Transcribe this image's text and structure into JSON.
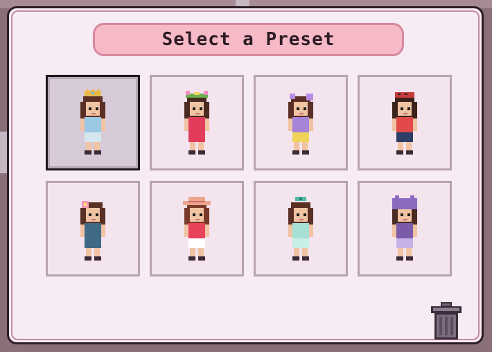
{
  "dialog": {
    "title": "Select a Preset"
  },
  "presets": [
    {
      "name": "preset-1",
      "accessory": "crown",
      "hair": "#5a2f24",
      "top": "#9ac9e6",
      "bottom": "#d5e6ee",
      "accent": "#e7b94a",
      "selected": true
    },
    {
      "name": "preset-2",
      "accessory": "flower-wreath",
      "hair": "#4a2b22",
      "top": "#e23c5d",
      "bottom": "#e23c5d",
      "accent": "#f18bc0",
      "selected": false
    },
    {
      "name": "preset-3",
      "accessory": "bow",
      "hair": "#5a2f24",
      "top": "#a583d9",
      "bottom": "#f0d45a",
      "accent": "#b78ee5",
      "selected": false
    },
    {
      "name": "preset-4",
      "accessory": "red-bandana",
      "hair": "#3b221b",
      "top": "#e24a4a",
      "bottom": "#2c3d66",
      "accent": "#c63b3b",
      "selected": false
    },
    {
      "name": "preset-5",
      "accessory": "pink-flower",
      "hair": "#5a2f24",
      "top": "#3f6a86",
      "bottom": "#3f6a86",
      "accent": "#f59ab6",
      "selected": false
    },
    {
      "name": "preset-6",
      "accessory": "sun-hat",
      "hair": "#7a3a2a",
      "top": "#e8435a",
      "bottom": "#ffffff",
      "accent": "#e9a58e",
      "selected": false
    },
    {
      "name": "preset-7",
      "accessory": "teal-bow",
      "hair": "#5a2f24",
      "top": "#a7e0d6",
      "bottom": "#c8efe6",
      "accent": "#4fb8a8",
      "selected": false
    },
    {
      "name": "preset-8",
      "accessory": "purple-hood",
      "hair": "#4a2b22",
      "top": "#7b5aa8",
      "bottom": "#c7b1e6",
      "accent": "#8a6bc0",
      "selected": false
    }
  ],
  "icons": {
    "trash": "trash-icon"
  }
}
